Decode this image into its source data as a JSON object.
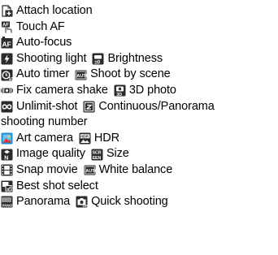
{
  "items": {
    "top_fragment": "",
    "attach_location": "Attach location",
    "touch_af": "Touch AF",
    "auto_focus": "Auto-focus",
    "shooting_light": "Shooting light",
    "brightness": "Brightness",
    "auto_timer": "Auto timer",
    "shoot_by_scene": "Shoot by scene",
    "fix_camera_shake": "Fix camera shake",
    "photo_3d": "3D photo",
    "unlimit_shot": "Unlimit-shot",
    "continuous_panorama": "Continuous/Panorama",
    "shooting_number": "shooting number",
    "art_camera": "Art camera",
    "hdr": "HDR",
    "image_quality": "Image quality",
    "size": "Size",
    "snap_movie": "Snap movie",
    "white_balance": "White balance",
    "best_shot_select": "Best shot select",
    "panorama": "Panorama",
    "quick_shooting": "Quick shooting"
  },
  "icons": {
    "attach_location": "attach-location-icon",
    "touch_af": "touch-af-icon",
    "auto_focus": "auto-focus-icon",
    "shooting_light": "shooting-light-icon",
    "brightness": "brightness-icon",
    "auto_timer": "auto-timer-icon",
    "shoot_by_scene": "shoot-by-scene-icon",
    "fix_camera_shake": "fix-camera-shake-icon",
    "photo_3d": "3d-photo-icon",
    "unlimit_shot": "unlimit-shot-icon",
    "continuous_panorama": "continuous-panorama-icon",
    "art_camera": "art-camera-icon",
    "hdr": "hdr-icon",
    "image_quality": "image-quality-icon",
    "size": "size-icon",
    "snap_movie": "snap-movie-icon",
    "white_balance": "white-balance-icon",
    "best_shot_select": "best-shot-select-icon",
    "panorama": "panorama-icon",
    "quick_shooting": "quick-shooting-icon"
  },
  "colors": {
    "text": "#000000",
    "icon_dark": "#2b2b2b",
    "art_camera_icon": "#1f8ed6",
    "background": "#ffffff"
  }
}
